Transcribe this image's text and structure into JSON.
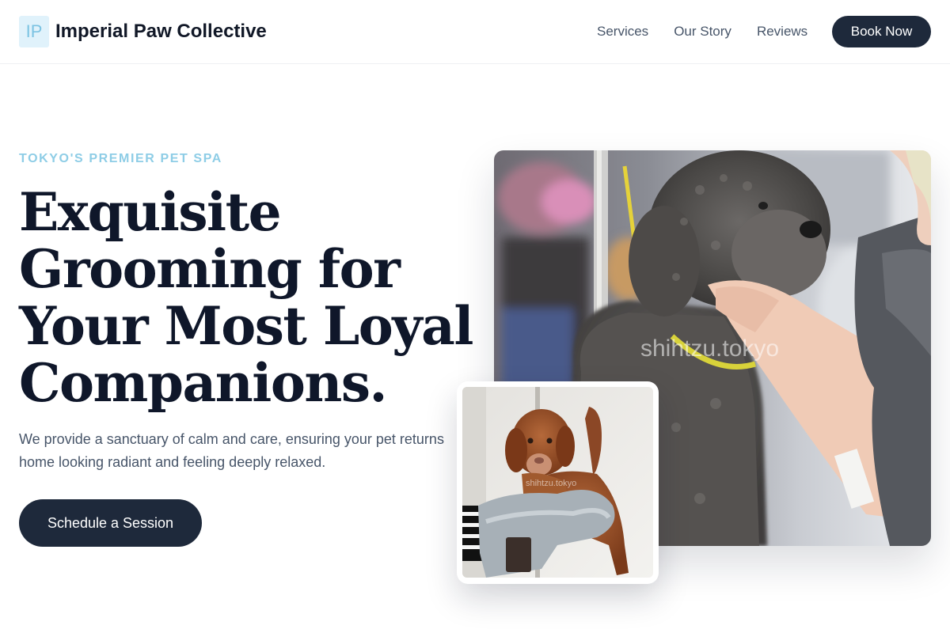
{
  "header": {
    "logo_initials": "IP",
    "brand_name": "Imperial Paw Collective",
    "nav": [
      {
        "label": "Services"
      },
      {
        "label": "Our Story"
      },
      {
        "label": "Reviews"
      }
    ],
    "book_label": "Book Now"
  },
  "hero": {
    "eyebrow": "TOKYO'S PREMIER PET SPA",
    "headline_lines": [
      "Exquisite",
      "Grooming for",
      "Your Most Loyal",
      "Companions."
    ],
    "subtext": "We provide a sanctuary of calm and care, ensuring your pet returns home looking radiant and feeling deeply relaxed.",
    "cta_label": "Schedule a Session"
  },
  "images": {
    "main_watermark": "shihtzu.tokyo",
    "inset_watermark": "shihtzu.tokyo"
  },
  "colors": {
    "primary_dark": "#1e293b",
    "accent_light_blue": "#8ecde6",
    "logo_bg": "#e0f2fb",
    "body_text": "#475569"
  }
}
